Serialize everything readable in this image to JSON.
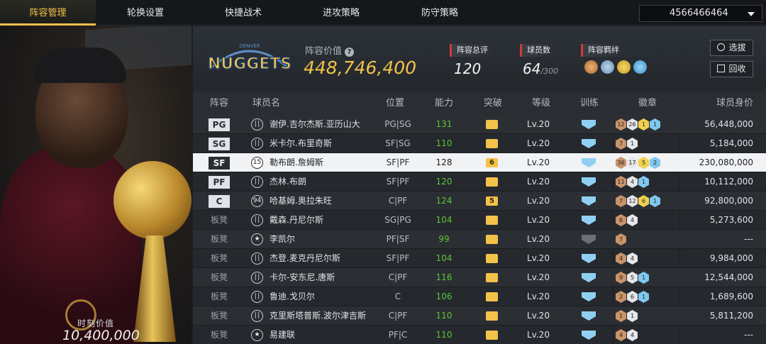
{
  "nav": {
    "tabs": [
      "阵容管理",
      "轮换设置",
      "快捷战术",
      "进攻策略",
      "防守策略"
    ],
    "account": "4566466464"
  },
  "portrait": {
    "value_label": "时刻价值",
    "value": "10,400,000"
  },
  "summary": {
    "team_logo_text": "NUGGETS",
    "lineup_value_label": "阵容价值",
    "lineup_value": "448,746,400",
    "overall_label": "阵容总评",
    "overall": "120",
    "player_count_label": "球员数",
    "player_count": "64",
    "player_count_max": "/300",
    "bond_label": "阵容羁绊",
    "bond_icons": [
      "bond-icon-1",
      "bond-icon-2",
      "bond-icon-3",
      "bond-icon-4"
    ],
    "select_button": "选拔",
    "recycle_button": "回收"
  },
  "table": {
    "headers": [
      "阵容",
      "球员名",
      "位置",
      "能力",
      "突破",
      "等级",
      "训练",
      "徽章",
      "球员身价"
    ],
    "rows": [
      {
        "slot": "PG",
        "icon": "ill",
        "name": "谢伊.吉尔杰斯.亚历山大",
        "pos": "PG|SG",
        "power": "131",
        "break": "",
        "level": "Lv.20",
        "badges": [
          [
            "12",
            "bronze"
          ],
          [
            "26",
            "silver"
          ],
          [
            "1",
            "gold"
          ],
          [
            "1",
            "blue"
          ]
        ],
        "value": "56,448,000"
      },
      {
        "slot": "SG",
        "icon": "ill",
        "name": "米卡尔.布里奇斯",
        "pos": "SF|SG",
        "power": "110",
        "break": "",
        "level": "Lv.20",
        "badges": [
          [
            "7",
            "bronze"
          ],
          [
            "1",
            "silver"
          ]
        ],
        "value": "5,184,000"
      },
      {
        "slot": "SF",
        "icon": "15",
        "name": "勒布朗.詹姆斯",
        "pos": "SF|PF",
        "power": "128",
        "break": "6",
        "level": "Lv.20",
        "badges": [
          [
            "36",
            "bronze"
          ],
          [
            "17",
            "silver"
          ],
          [
            "5",
            "gold"
          ],
          [
            "2",
            "blue"
          ]
        ],
        "value": "230,080,000"
      },
      {
        "slot": "PF",
        "icon": "ill",
        "name": "杰林.布朗",
        "pos": "SF|PF",
        "power": "120",
        "break": "",
        "level": "Lv.20",
        "badges": [
          [
            "11",
            "bronze"
          ],
          [
            "4",
            "silver"
          ],
          [
            "1",
            "blue"
          ]
        ],
        "value": "10,112,000"
      },
      {
        "slot": "C",
        "icon": "94",
        "name": "哈基姆.奥拉朱旺",
        "pos": "C|PF",
        "power": "124",
        "break": "5",
        "level": "Lv.20",
        "badges": [
          [
            "7",
            "bronze"
          ],
          [
            "12",
            "silver"
          ],
          [
            "6",
            "gold"
          ],
          [
            "1",
            "blue"
          ]
        ],
        "value": "92,800,000"
      },
      {
        "slot": "板凳",
        "icon": "ill",
        "name": "戴森.丹尼尔斯",
        "pos": "SG|PG",
        "power": "104",
        "break": "",
        "level": "Lv.20",
        "badges": [
          [
            "6",
            "bronze"
          ],
          [
            "4",
            "silver"
          ]
        ],
        "value": "5,273,600"
      },
      {
        "slot": "板凳",
        "icon": "star",
        "name": "李凯尔",
        "pos": "PF|SF",
        "power": "99",
        "break": "",
        "level": "Lv.20",
        "badges": [
          [
            "7",
            "bronze"
          ]
        ],
        "value": "---"
      },
      {
        "slot": "板凳",
        "icon": "ill",
        "name": "杰登.麦克丹尼尔斯",
        "pos": "SF|PF",
        "power": "104",
        "break": "",
        "level": "Lv.20",
        "badges": [
          [
            "4",
            "bronze"
          ],
          [
            "4",
            "silver"
          ]
        ],
        "value": "9,984,000"
      },
      {
        "slot": "板凳",
        "icon": "ill",
        "name": "卡尔-安东尼.唐斯",
        "pos": "C|PF",
        "power": "116",
        "break": "",
        "level": "Lv.20",
        "badges": [
          [
            "9",
            "bronze"
          ],
          [
            "5",
            "silver"
          ],
          [
            "1",
            "blue"
          ]
        ],
        "value": "12,544,000"
      },
      {
        "slot": "板凳",
        "icon": "ill",
        "name": "鲁迪.戈贝尔",
        "pos": "C",
        "power": "106",
        "break": "",
        "level": "Lv.20",
        "badges": [
          [
            "2",
            "bronze"
          ],
          [
            "6",
            "silver"
          ],
          [
            "1",
            "blue"
          ]
        ],
        "value": "1,689,600"
      },
      {
        "slot": "板凳",
        "icon": "ill",
        "name": "克里斯塔普斯.波尔津吉斯",
        "pos": "C|PF",
        "power": "110",
        "break": "",
        "level": "Lv.20",
        "badges": [
          [
            "1",
            "bronze"
          ],
          [
            "1",
            "silver"
          ]
        ],
        "value": "5,811,200"
      },
      {
        "slot": "板凳",
        "icon": "star",
        "name": "易建联",
        "pos": "PF|C",
        "power": "110",
        "break": "",
        "level": "Lv.20",
        "badges": [
          [
            "4",
            "bronze"
          ],
          [
            "4",
            "silver"
          ]
        ],
        "value": "---"
      }
    ]
  }
}
